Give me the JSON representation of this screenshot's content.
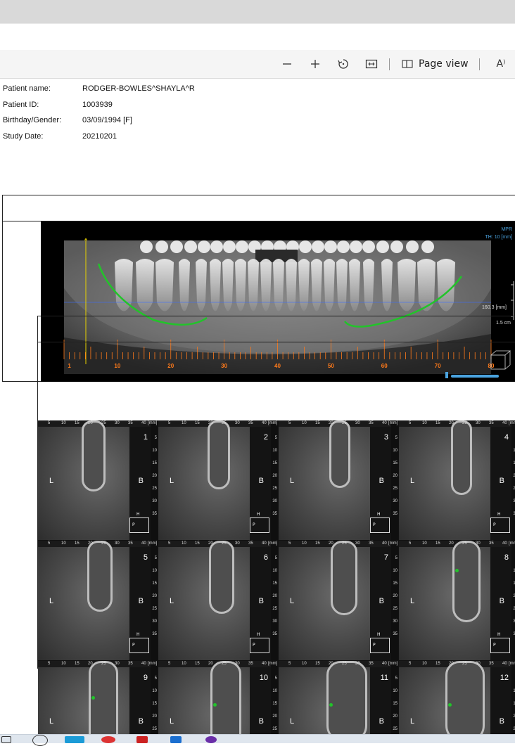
{
  "browser": {
    "toolbar": {
      "zoom_out_icon": "minus-icon",
      "zoom_in_icon": "plus-icon",
      "rotate_icon": "rotate-icon",
      "fit_icon": "fit-width-icon",
      "page_view_label": "Page view",
      "read_aloud_icon": "read-aloud-icon",
      "read_aloud_glyph": "A⁾"
    }
  },
  "patient": {
    "rows": [
      {
        "label": "Patient name:",
        "value": "RODGER-BOWLES^SHAYLA^R"
      },
      {
        "label": "Patient ID:",
        "value": "1003939"
      },
      {
        "label": "Birthday/Gender:",
        "value": "03/09/1994 [F]"
      },
      {
        "label": "Study Date:",
        "value": "20210201"
      }
    ]
  },
  "panorama": {
    "mode": "MPR",
    "thickness": "TH: 10 [mm]",
    "length": "160.3 [mm]",
    "scale": "1.5 cm",
    "axis_labels": [
      "1",
      "10",
      "20",
      "30",
      "40",
      "50",
      "60",
      "70",
      "80"
    ]
  },
  "cross_sections": {
    "side_left": "L",
    "side_right": "B",
    "unit": "[mm]",
    "ticks": [
      "5",
      "10",
      "15",
      "20",
      "25",
      "30",
      "35",
      "40"
    ],
    "vticks": [
      "5",
      "10",
      "15",
      "20",
      "25",
      "30",
      "35"
    ],
    "cube": [
      "H",
      "P"
    ],
    "numbers": [
      "1",
      "2",
      "3",
      "4",
      "5",
      "6",
      "7",
      "8",
      "9",
      "10",
      "11",
      "12"
    ]
  },
  "colors": {
    "nerve": "#22c42a",
    "axis": "#ff7a1a",
    "cursor": "#e8d200",
    "guide": "#3b6cff",
    "slider": "#4aa3df"
  }
}
